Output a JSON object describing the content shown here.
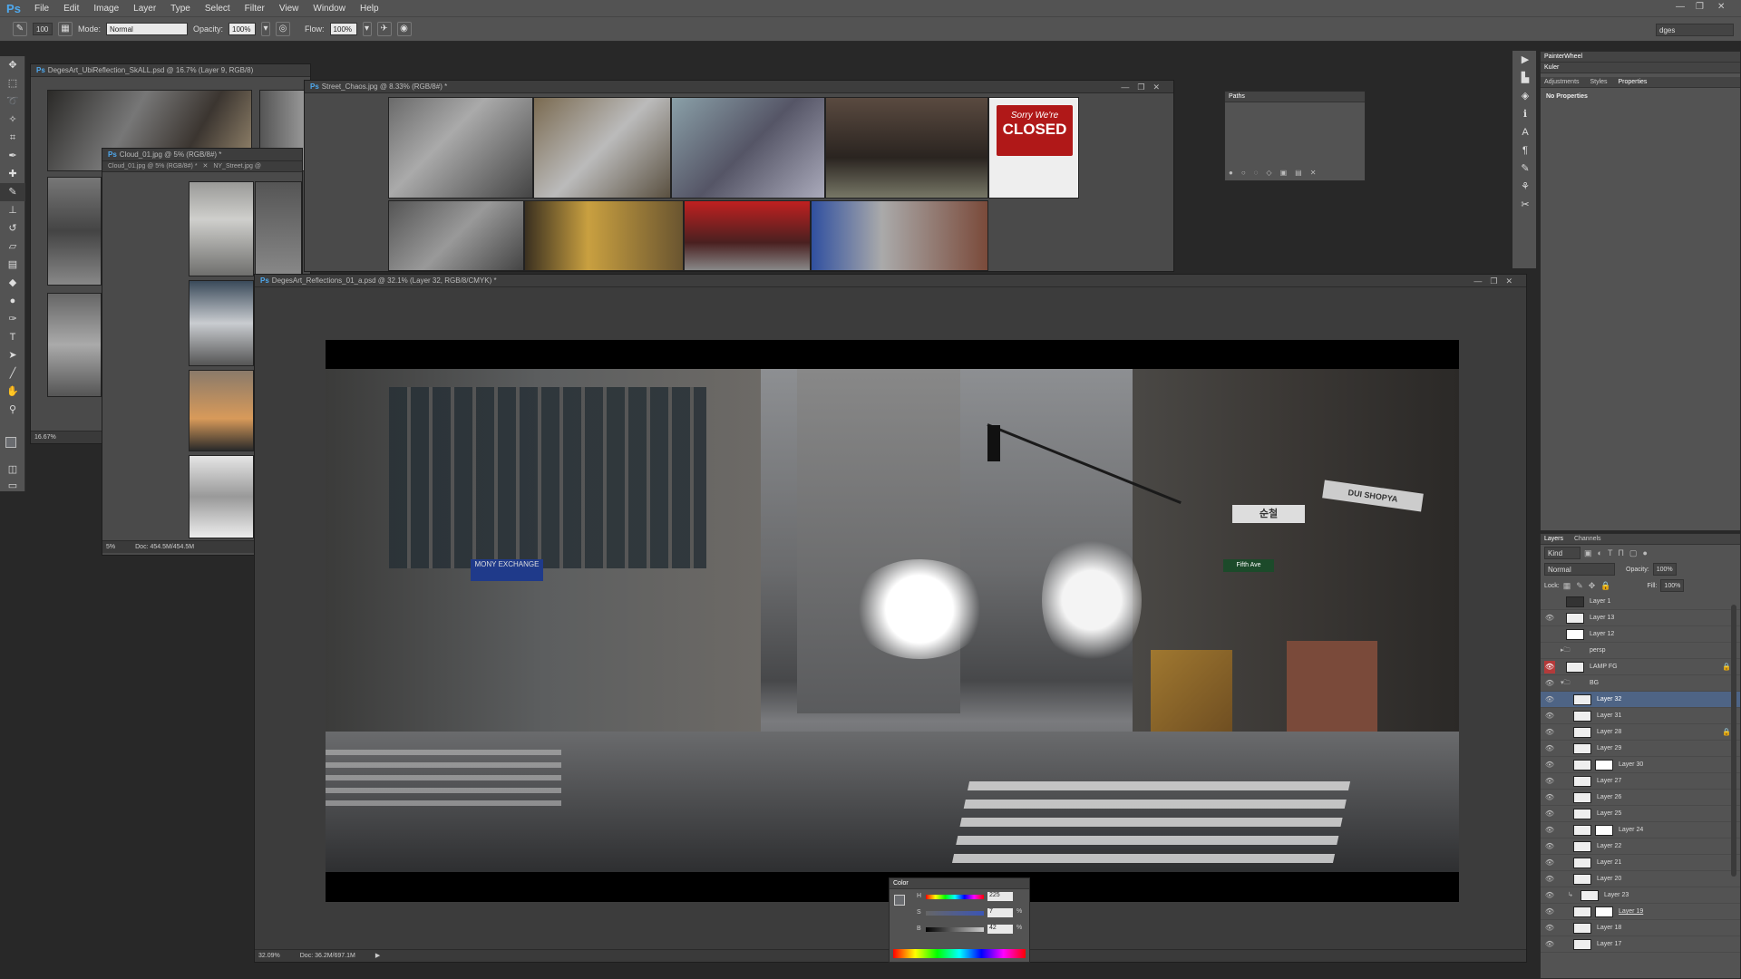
{
  "app": {
    "logo": "Ps"
  },
  "menu": [
    "File",
    "Edit",
    "Image",
    "Layer",
    "Type",
    "Select",
    "Filter",
    "View",
    "Window",
    "Help"
  ],
  "options": {
    "brush_size": "100",
    "mode_label": "Mode:",
    "mode_value": "Normal",
    "opacity_label": "Opacity:",
    "opacity_value": "100%",
    "flow_label": "Flow:",
    "flow_value": "100%",
    "workspace": "dges"
  },
  "windows": {
    "unreflection": {
      "title": "DegesArt_UbiReflection_SkALL.psd @ 16.7% (Layer 9, RGB/8)",
      "zoom": "16.67%"
    },
    "cloud": {
      "title": "Cloud_01.jpg @ 5% (RGB/8#) *",
      "tab1": "Cloud_01.jpg @ 5% (RGB/8#) *",
      "tab2": "NY_Street.jpg @",
      "zoom": "5%",
      "doc": "Doc: 454.5M/454.5M"
    },
    "street": {
      "title": "Street_Chaos.jpg @ 8.33% (RGB/8#) *",
      "sign_line1": "Sorry We're",
      "sign_line2": "CLOSED"
    },
    "main": {
      "title": "DegesArt_Reflections_01_a.psd @ 32.1% (Layer 32, RGB/8/CMYK) *",
      "zoom": "32.09%",
      "doc": "Doc: 36.2M/697.1M"
    }
  },
  "scene": {
    "sign_money": "MONY EXCHANGE",
    "sign_fifth": "Fifth Ave",
    "sign_korean": "순철",
    "sign_shop": "DUI SHOPYA"
  },
  "paths_panel": {
    "title": "Paths"
  },
  "color_panel": {
    "title": "Color",
    "h_label": "H",
    "h_value": "225",
    "s_label": "S",
    "s_value": "7",
    "b_label": "B",
    "b_value": "42",
    "percent": "%"
  },
  "right_panel": {
    "tab_painterwheel": "PainterWheel",
    "tab_kuler": "Kuler",
    "tabs": [
      "Adjustments",
      "Styles",
      "Properties"
    ],
    "no_properties": "No Properties"
  },
  "layers_panel": {
    "tabs": [
      "Layers",
      "Channels"
    ],
    "kind": "Kind",
    "blend": "Normal",
    "opacity_label": "Opacity:",
    "opacity_value": "100%",
    "lock_label": "Lock:",
    "fill_label": "Fill:",
    "fill_value": "100%",
    "layers": [
      "Layer 1",
      "Layer 13",
      "Layer 12",
      "persp",
      "LAMP FG",
      "BG",
      "Layer 32",
      "Layer 31",
      "Layer 28",
      "Layer 29",
      "Layer 30",
      "Layer 27",
      "Layer 26",
      "Layer 25",
      "Layer 24",
      "Layer 22",
      "Layer 21",
      "Layer 20",
      "Layer 23",
      "Layer 19",
      "Layer 18",
      "Layer 17"
    ]
  },
  "colors": {
    "accent": "#4fa9ee",
    "selection": "#4e6485",
    "chrome": "#535353"
  }
}
